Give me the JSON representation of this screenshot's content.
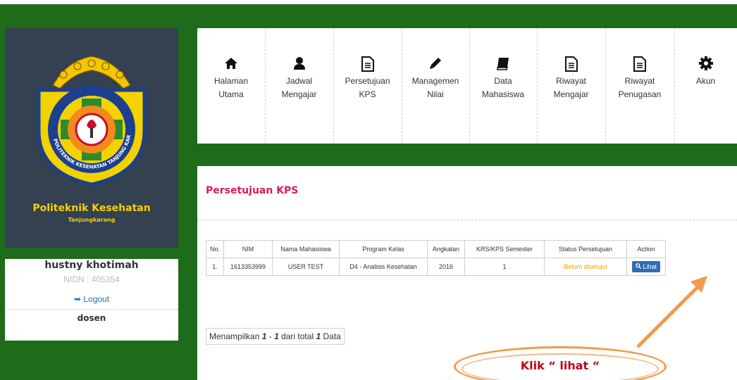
{
  "brand": {
    "name": "Politeknik Kesehatan",
    "sub": "Tanjungkarang",
    "logo_text": "POLITEKNIK KESEHATAN TANJUNG KARANG"
  },
  "user": {
    "name": "hustny khotimah",
    "nidn": "NIDN : 405354",
    "logout": "Logout",
    "role": "dosen"
  },
  "nav": {
    "items": [
      {
        "line1": "Halaman",
        "line2": "Utama",
        "icon": "home-icon"
      },
      {
        "line1": "Jadwal",
        "line2": "Mengajar",
        "icon": "user-icon"
      },
      {
        "line1": "Persetujuan",
        "line2": "KPS",
        "icon": "document-icon"
      },
      {
        "line1": "Managemen",
        "line2": "Nilai",
        "icon": "pencil-icon"
      },
      {
        "line1": "Data",
        "line2": "Mahasiswa",
        "icon": "book-icon"
      },
      {
        "line1": "Riwayat",
        "line2": "Mengajar",
        "icon": "document-icon"
      },
      {
        "line1": "Riwayat",
        "line2": "Penugasan",
        "icon": "document-icon"
      },
      {
        "line1": "Akun",
        "line2": "",
        "icon": "gear-icon"
      }
    ]
  },
  "panel": {
    "title": "Persetujuan KPS"
  },
  "table": {
    "headers": [
      "No.",
      "NIM",
      "Nama Mahasiswa",
      "Program Kelas",
      "Angkatan",
      "KRS/KPS Semester",
      "Status Persetujuan",
      "Action"
    ],
    "rows": [
      {
        "no": "1.",
        "nim": "1613353999",
        "nama": "USER TEST",
        "program": "D4 - Analisis Kesehatan",
        "angkatan": "2016",
        "semester": "1",
        "status": "Belum disetujui",
        "action": "Lihat"
      }
    ]
  },
  "footer": {
    "prefix": "Menampilkan ",
    "from": "1",
    "sep": " - ",
    "to": "1",
    "mid": " dari total ",
    "total": "1",
    "suffix": " Data"
  },
  "annotation": {
    "text": "Klik “ lihat “"
  },
  "colors": {
    "frame_green": "#1e6b1a",
    "sidebar_dark": "#334150",
    "brand_yellow": "#f5d200",
    "title_pink": "#d81b5a",
    "status_orange": "#e8a000",
    "button_blue": "#2f6db5",
    "callout_orange": "#f39a4c"
  }
}
